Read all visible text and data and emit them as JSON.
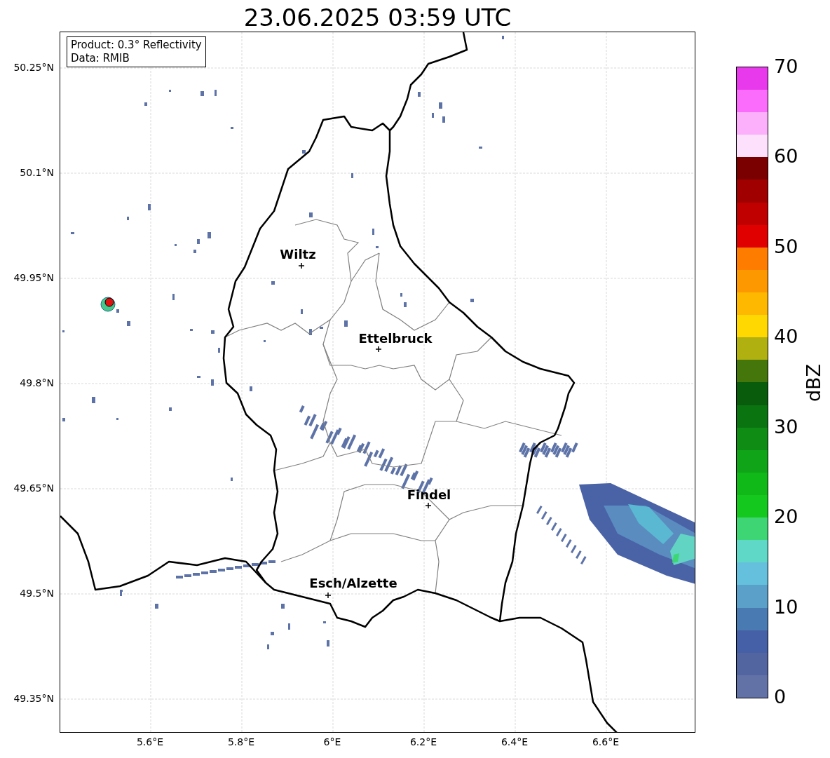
{
  "title": "23.06.2025 03:59 UTC",
  "info_box": {
    "lines": [
      "Product: 0.3° Reflectivity",
      "Data: RMIB"
    ]
  },
  "y_axis": {
    "ticks": [
      "50.25°N",
      "50.1°N",
      "49.95°N",
      "49.8°N",
      "49.65°N",
      "49.5°N",
      "49.35°N"
    ]
  },
  "x_axis": {
    "ticks": [
      "5.6°E",
      "5.8°E",
      "6°E",
      "6.2°E",
      "6.4°E",
      "6.6°E"
    ]
  },
  "cities": [
    "Wiltz",
    "Ettelbruck",
    "Findel",
    "Esch/Alzette"
  ],
  "colorbar": {
    "label": "dBZ",
    "ticks": [
      "70",
      "60",
      "50",
      "40",
      "30",
      "20",
      "10",
      "0"
    ],
    "bins": [
      {
        "color": "#6272a6"
      },
      {
        "color": "#5365a0"
      },
      {
        "color": "#4560a6"
      },
      {
        "color": "#4a7ab2"
      },
      {
        "color": "#5aa0c8"
      },
      {
        "color": "#64c0dc"
      },
      {
        "color": "#60d8c8"
      },
      {
        "color": "#3ed674"
      },
      {
        "color": "#14c81e"
      },
      {
        "color": "#10b818"
      },
      {
        "color": "#10a418"
      },
      {
        "color": "#0e8c14"
      },
      {
        "color": "#0a7410"
      },
      {
        "color": "#085c0c"
      },
      {
        "color": "#44760c"
      },
      {
        "color": "#b0b010"
      },
      {
        "color": "#fed800"
      },
      {
        "color": "#feb800"
      },
      {
        "color": "#fe9800"
      },
      {
        "color": "#fe7c00"
      },
      {
        "color": "#e00000"
      },
      {
        "color": "#c00000"
      },
      {
        "color": "#a00000"
      },
      {
        "color": "#7a0000"
      },
      {
        "color": "#fde0fc"
      },
      {
        "color": "#fcb0fc"
      },
      {
        "color": "#fc6cfc"
      },
      {
        "color": "#e83aec"
      }
    ]
  }
}
